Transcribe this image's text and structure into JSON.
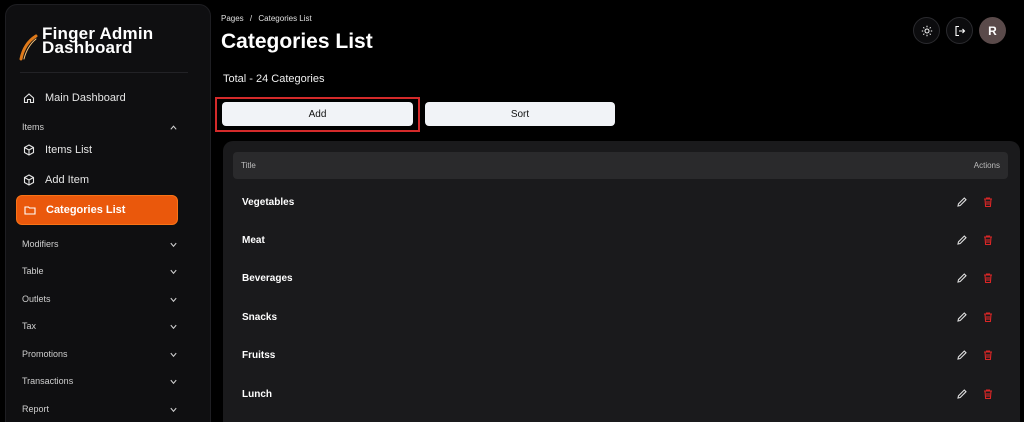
{
  "sidebar": {
    "brand": {
      "line1": "Finger Admin",
      "line2": "Dashboard"
    },
    "main_dashboard": "Main Dashboard",
    "items_section": "Items",
    "items": [
      {
        "label": "Items List",
        "icon": "cube-icon"
      },
      {
        "label": "Add Item",
        "icon": "cube-icon"
      },
      {
        "label": "Categories List",
        "icon": "folder-icon",
        "active": true
      }
    ],
    "sections": [
      "Modifiers",
      "Table",
      "Outlets",
      "Tax",
      "Promotions",
      "Transactions",
      "Report"
    ]
  },
  "breadcrumb": {
    "root": "Pages",
    "sep": "/",
    "current": "Categories List"
  },
  "page_title": "Categories List",
  "total": "Total - 24 Categories",
  "buttons": {
    "add": "Add",
    "sort": "Sort"
  },
  "table": {
    "headers": {
      "title": "Title",
      "actions": "Actions"
    },
    "rows": [
      "Vegetables",
      "Meat",
      "Beverages",
      "Snacks",
      "Fruitss",
      "Lunch"
    ]
  },
  "user": {
    "initial": "R"
  },
  "colors": {
    "accent": "#ea580c",
    "delete": "#dc2626",
    "highlight": "#d42a2a"
  }
}
